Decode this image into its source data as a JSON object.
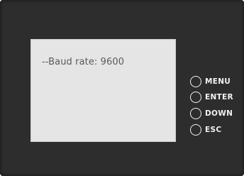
{
  "display": {
    "text": "--Baud rate: 9600"
  },
  "keys": [
    {
      "label": "MENU"
    },
    {
      "label": "ENTER"
    },
    {
      "label": "DOWN"
    },
    {
      "label": "ESC"
    }
  ]
}
